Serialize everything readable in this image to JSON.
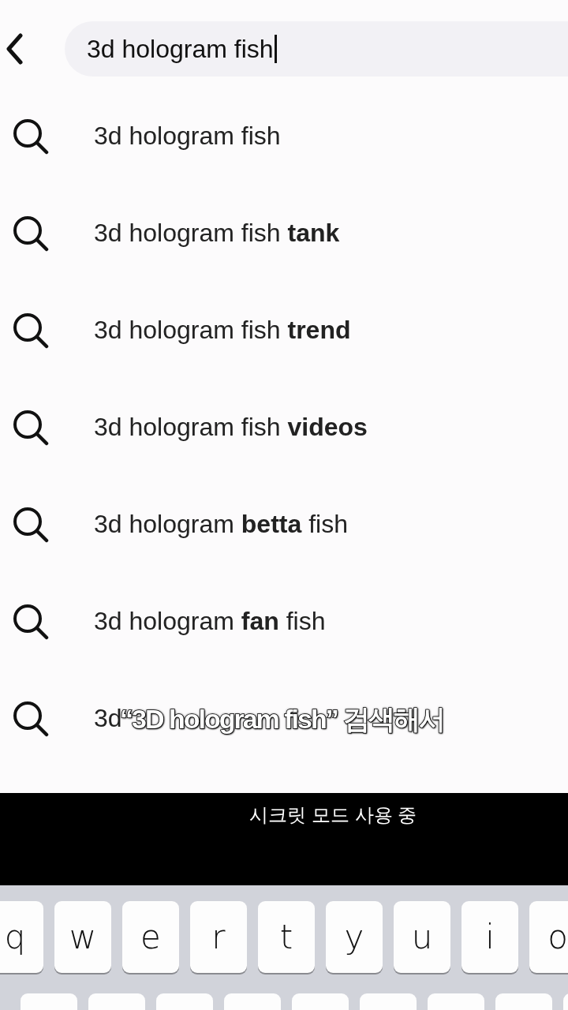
{
  "search": {
    "value": "3d hologram fish"
  },
  "suggestions": [
    "3d hologram fish",
    "3d hologram fish **tank**",
    "3d hologram fish **trend**",
    "3d hologram fish **videos**",
    "3d hologram **betta** fish",
    "3d hologram **fan** fish",
    "3d"
  ],
  "caption": "“3D hologram fish” 검색해서",
  "incognito_banner": "시크릿 모드 사용 중",
  "keyboard": {
    "row_1": [
      "q",
      "w",
      "e",
      "r",
      "t",
      "y",
      "u",
      "i",
      "o"
    ]
  }
}
